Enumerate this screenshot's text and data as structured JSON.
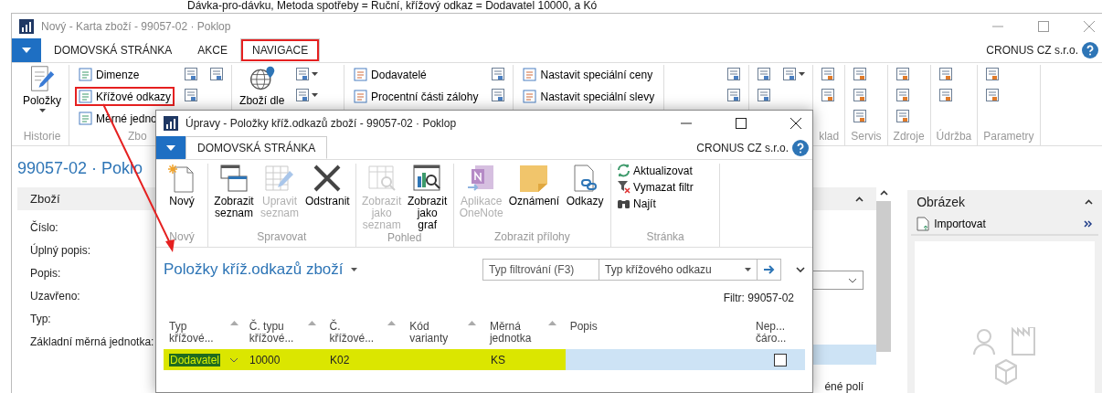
{
  "caption": "Dávka-pro-dávku, Metoda spotřeby = Ruční, křížový odkaz = Dodavatel 10000, a Kó",
  "main_window": {
    "title": "Nový - Karta zboží - 99057-02 · Poklop",
    "tabs": [
      {
        "label": "DOMOVSKÁ STRÁNKA",
        "selected": false,
        "highlighted": false
      },
      {
        "label": "AKCE",
        "selected": false,
        "highlighted": false
      },
      {
        "label": "NAVIGACE",
        "selected": true,
        "highlighted": true
      }
    ],
    "company": "CRONUS CZ s.r.o.",
    "ribbon_groups": [
      {
        "label": "Historie",
        "columns": [
          [
            {
              "kind": "large",
              "label": "Položky",
              "dropdown": true
            }
          ]
        ]
      },
      {
        "label": "Zbo",
        "columns": [
          [
            {
              "kind": "small",
              "label": "Dimenze",
              "highlighted": false
            },
            {
              "kind": "small",
              "label": "Křížové odkazy",
              "highlighted": true
            },
            {
              "kind": "small",
              "label": "Měrné jedno",
              "highlighted": false
            }
          ],
          [
            {
              "kind": "icon",
              "dropdown": false
            },
            {
              "kind": "icon",
              "dropdown": false
            }
          ],
          [
            {
              "kind": "icon",
              "dropdown": false
            }
          ]
        ]
      },
      {
        "columns": [
          [
            {
              "kind": "large",
              "label": "Zboží dle",
              "dropdown": false
            }
          ],
          [
            {
              "kind": "icon",
              "dropdown": true
            },
            {
              "kind": "icon",
              "dropdown": true
            }
          ]
        ]
      },
      {
        "columns": [
          [
            {
              "kind": "small",
              "label": "Dodavatelé",
              "highlighted": false
            },
            {
              "kind": "small",
              "label": "Procentní části zálohy",
              "highlighted": false
            }
          ],
          [
            {
              "kind": "icon",
              "dropdown": false
            },
            {
              "kind": "icon",
              "dropdown": false
            }
          ]
        ]
      },
      {
        "columns": [
          [
            {
              "kind": "small",
              "label": "Nastavit speciální ceny",
              "highlighted": false
            },
            {
              "kind": "small",
              "label": "Nastavit speciální slevy",
              "highlighted": false
            }
          ]
        ]
      },
      {
        "columns": [
          [
            {
              "kind": "icon",
              "dropdown": false
            },
            {
              "kind": "icon",
              "dropdown": false
            }
          ]
        ]
      },
      {
        "columns": [
          [
            {
              "kind": "icon",
              "dropdown": false
            },
            {
              "kind": "icon",
              "dropdown": false
            }
          ],
          [
            {
              "kind": "icon",
              "dropdown": true
            }
          ]
        ]
      },
      {
        "label": "klad",
        "columns": [
          [
            {
              "kind": "icon",
              "dropdown": false
            },
            {
              "kind": "icon",
              "dropdown": false
            }
          ]
        ]
      },
      {
        "label": "Servis",
        "columns": [
          [
            {
              "kind": "icon",
              "dropdown": false
            },
            {
              "kind": "icon",
              "dropdown": false
            },
            {
              "kind": "icon",
              "dropdown": false
            }
          ]
        ]
      },
      {
        "label": "Zdroje",
        "columns": [
          [
            {
              "kind": "icon",
              "dropdown": false
            },
            {
              "kind": "icon",
              "dropdown": false
            },
            {
              "kind": "icon",
              "dropdown": false
            }
          ]
        ]
      },
      {
        "label": "Údržba",
        "columns": [
          [
            {
              "kind": "icon",
              "dropdown": false
            },
            {
              "kind": "icon",
              "dropdown": false
            }
          ]
        ]
      },
      {
        "label": "Parametry",
        "columns": [
          [
            {
              "kind": "icon",
              "dropdown": false
            },
            {
              "kind": "icon",
              "dropdown": false
            }
          ]
        ]
      }
    ],
    "page_title": "99057-02 · Poklo",
    "section": {
      "title": "Zboží",
      "expanded": true,
      "fields": [
        "Číslo:",
        "Úplný popis:",
        "Popis:",
        "Uzavřeno:",
        "Typ:",
        "Základní měrná jednotka:"
      ],
      "footer_text": "éné polí"
    },
    "picture_panel": {
      "title": "Obrázek",
      "expanded": true,
      "action": "Importovat"
    }
  },
  "dialog": {
    "title": "Úpravy - Položky kříž.odkazů zboží - 99057-02 · Poklop",
    "tabs": [
      {
        "label": "DOMOVSKÁ STRÁNKA",
        "selected": true
      }
    ],
    "company": "CRONUS CZ s.r.o.",
    "ribbon_groups": [
      {
        "label": "Nový",
        "items": [
          {
            "kind": "large",
            "label": "Nový",
            "disabled": false
          }
        ]
      },
      {
        "label": "Spravovat",
        "items": [
          {
            "kind": "large",
            "label": "Zobrazit seznam",
            "disabled": false
          },
          {
            "kind": "large",
            "label": "Upravit seznam",
            "disabled": true
          },
          {
            "kind": "large",
            "label": "Odstranit",
            "disabled": false
          }
        ]
      },
      {
        "label": "Pohled",
        "items": [
          {
            "kind": "large",
            "label": "Zobrazit jako seznam",
            "disabled": true
          },
          {
            "kind": "large",
            "label": "Zobrazit jako graf",
            "disabled": false
          }
        ]
      },
      {
        "label": "Zobrazit přílohy",
        "items": [
          {
            "kind": "large",
            "label": "Aplikace OneNote",
            "disabled": true
          },
          {
            "kind": "large",
            "label": "Oznámení",
            "disabled": false
          },
          {
            "kind": "large",
            "label": "Odkazy",
            "disabled": false
          }
        ]
      },
      {
        "label": "Stránka",
        "items": [
          {
            "kind": "small",
            "label": "Aktualizovat",
            "disabled": false
          },
          {
            "kind": "small",
            "label": "Vymazat filtr",
            "disabled": false
          },
          {
            "kind": "small",
            "label": "Najít",
            "disabled": false
          }
        ]
      }
    ],
    "list_title": "Položky kříž.odkazů zboží",
    "filter": {
      "placeholder": "Typ filtrování (F3)",
      "field": "Typ křížového odkazu"
    },
    "filter_note": "Filtr: 99057-02",
    "table": {
      "columns": [
        "Typ křížové...",
        "Č. typu křížové...",
        "Č. křížové...",
        "Kód varianty",
        "Měrná jednotka",
        "Popis",
        "Nep... čáro..."
      ],
      "rows": [
        {
          "selected": true,
          "highlighted": true,
          "type": "Dodavatel",
          "type_no": "10000",
          "ref_no": "K02",
          "unit": "KS",
          "blocked": false
        }
      ]
    }
  }
}
